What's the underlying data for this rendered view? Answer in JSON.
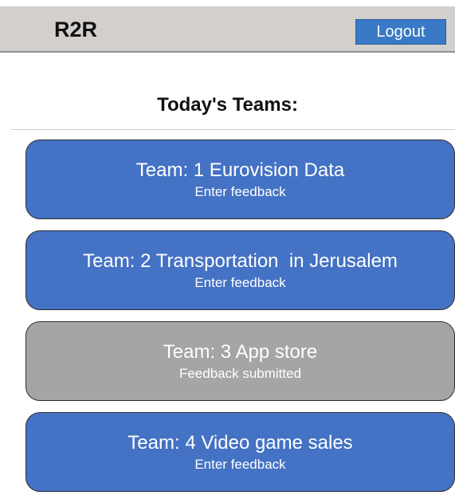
{
  "header": {
    "brand": "R2R",
    "logout_label": "Logout"
  },
  "main": {
    "title": "Today's Teams:",
    "teams": [
      {
        "name": "Team: 1 Eurovision Data",
        "status": "Enter feedback",
        "state": "pending"
      },
      {
        "name": "Team: 2 Transportation  in Jerusalem",
        "status": "Enter feedback",
        "state": "pending"
      },
      {
        "name": "Team: 3 App store",
        "status": "Feedback submitted",
        "state": "submitted"
      },
      {
        "name": "Team: 4 Video game sales",
        "status": "Enter feedback",
        "state": "pending"
      }
    ]
  },
  "colors": {
    "header_bg": "#d3cfcd",
    "accent": "#3979c5",
    "card_pending": "#4472c4",
    "card_submitted": "#a5a5a5"
  }
}
